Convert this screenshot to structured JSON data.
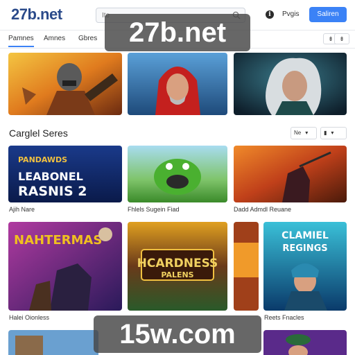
{
  "brand": {
    "logo": "27b.net",
    "accent": "#3b82f6"
  },
  "header": {
    "search_placeholder": "Ite",
    "login_label": "Pvgis",
    "signup_label": "Saliren"
  },
  "tabs": [
    {
      "label": "Pamnes"
    },
    {
      "label": "Amnes"
    },
    {
      "label": "Gbres"
    }
  ],
  "tab_tools": [
    "⇟",
    "⇟"
  ],
  "section": {
    "title": "Carglel Seres",
    "sort_label": "Ne",
    "view_label": "▮"
  },
  "cards": [
    {
      "caption": "Ajih Nare",
      "poster_lines": [
        "PANDAWDS",
        "LEABONEL",
        "RASNIS 2"
      ]
    },
    {
      "caption": "Fhlels Sugein Fiad"
    },
    {
      "caption": "Dadd Admdl Reuane"
    },
    {
      "caption": "Halei Oionless",
      "poster_lines": [
        "NAHTERMAS"
      ]
    },
    {
      "caption": "",
      "poster_lines": [
        "HCARDNESS",
        "PALENS"
      ]
    },
    {
      "caption": "Reets Fnacles",
      "poster_lines": [
        "CLAMIEL",
        "REGINGS"
      ]
    }
  ],
  "watermarks": [
    "27b.net",
    "15w.com"
  ]
}
